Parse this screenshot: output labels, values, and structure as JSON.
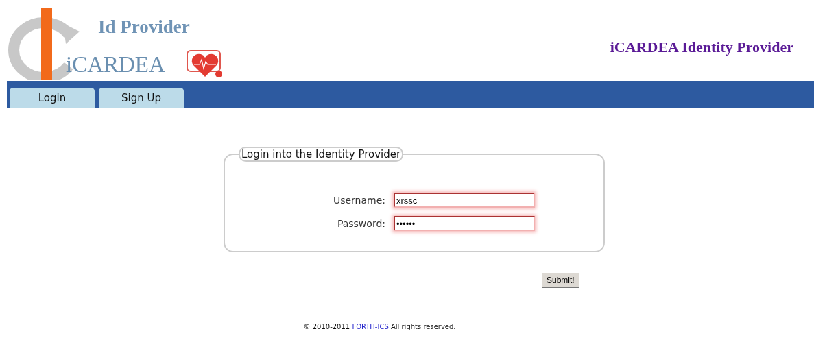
{
  "header": {
    "logo_top": "Id Provider",
    "logo_bottom": "iCARDEA",
    "site_title": "iCARDEA Identity Provider"
  },
  "tabs": [
    {
      "label": "Login"
    },
    {
      "label": "Sign Up"
    }
  ],
  "login": {
    "legend": "Login into the Identity Provider",
    "fields": [
      {
        "label": "Username:",
        "value": "xrssc",
        "invalid": true
      },
      {
        "label": "Password:",
        "value": "••••••",
        "invalid": true
      }
    ],
    "submit": "Submit!"
  },
  "footer": {
    "copyright": "© 2010-2011",
    "link": "FORTH-ICS",
    "rest": "All rights reserved."
  }
}
